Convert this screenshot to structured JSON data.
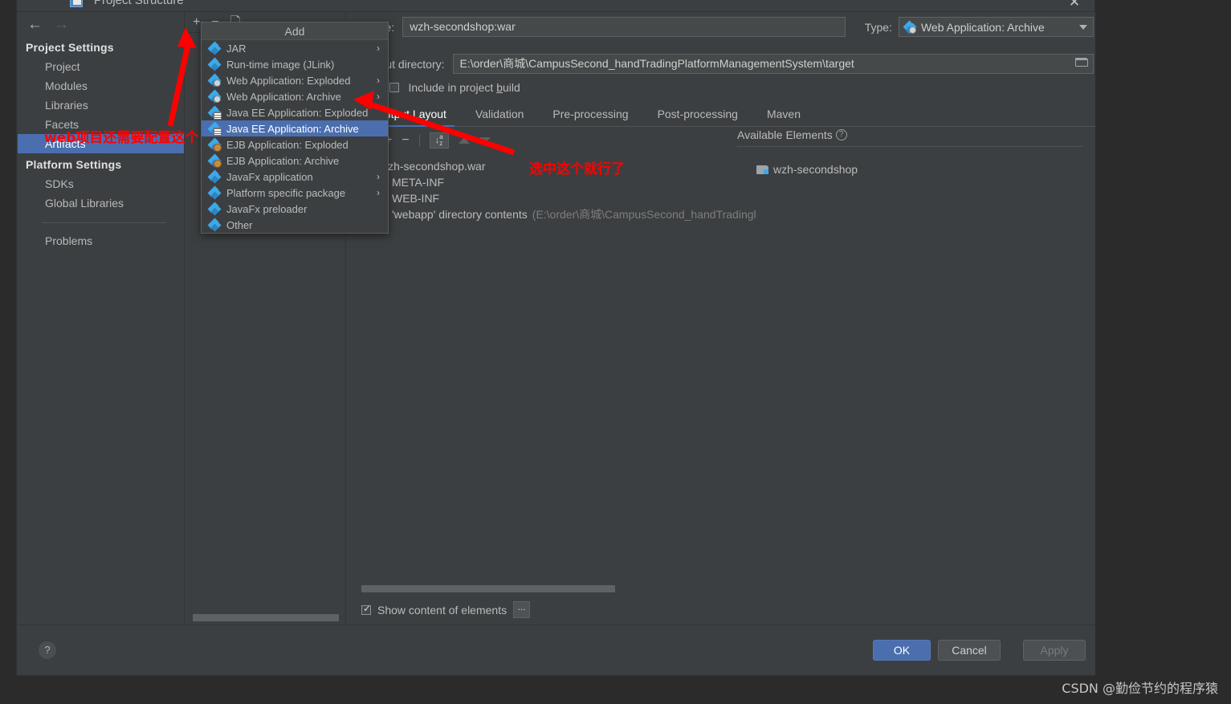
{
  "window": {
    "title": "Project Structure",
    "close_label": "✕",
    "icon": "project-structure-icon"
  },
  "nav": {
    "back_label": "←",
    "forward_label": "→",
    "groups": [
      {
        "title": "Project Settings",
        "items": [
          {
            "label": "Project",
            "selected": false
          },
          {
            "label": "Modules",
            "selected": false
          },
          {
            "label": "Libraries",
            "selected": false
          },
          {
            "label": "Facets",
            "selected": false
          },
          {
            "label": "Artifacts",
            "selected": true
          }
        ]
      },
      {
        "title": "Platform Settings",
        "items": [
          {
            "label": "SDKs",
            "selected": false
          },
          {
            "label": "Global Libraries",
            "selected": false
          }
        ]
      }
    ],
    "problems_label": "Problems"
  },
  "artifacts_toolbar": {
    "add_label": "+",
    "remove_label": "−",
    "copy_label": "copy-icon"
  },
  "content": {
    "name_label": "Name:",
    "name_value": "wzh-secondshop:war",
    "type_label": "Type:",
    "type_value": "Web Application: Archive",
    "output_dir_label": "Output directory:",
    "output_dir_value": "E:\\order\\商城\\CampusSecond_handTradingPlatformManagementSystem\\target",
    "include_in_build_label_pre": "Include in project ",
    "include_in_build_label_key": "b",
    "include_in_build_label_post": "uild",
    "include_in_build_checked": false,
    "tabs": [
      {
        "label": "Output Layout",
        "active": true
      },
      {
        "label": "Validation",
        "active": false
      },
      {
        "label": "Pre-processing",
        "active": false
      },
      {
        "label": "Post-processing",
        "active": false
      },
      {
        "label": "Maven",
        "active": false
      }
    ],
    "layout_toolbar": {
      "jar_label": "create-archive-icon",
      "add_label": "+",
      "remove_label": "−",
      "sort_label": "sort-az-icon",
      "move_up_label": "move-up-icon",
      "move_down_label": "move-down-icon"
    },
    "output_tree": [
      {
        "label": "wzh-secondshop.war",
        "icon": "war-icon",
        "depth": 0,
        "hint": ""
      },
      {
        "label": "META-INF",
        "icon": "folder-icon",
        "depth": 1,
        "hint": ""
      },
      {
        "label": "WEB-INF",
        "icon": "folder-icon",
        "depth": 1,
        "hint": ""
      },
      {
        "label": "'webapp' directory contents",
        "icon": "dir-contents-icon",
        "depth": 1,
        "hint": "(E:\\order\\商城\\CampusSecond_handTradingl"
      }
    ],
    "available_elements_label": "Available Elements",
    "available_help_label": "?",
    "available_tree": [
      {
        "label": "wzh-secondshop",
        "icon": "module-folder-icon"
      }
    ],
    "show_content_label": "Show content of elements",
    "show_content_checked": true,
    "more_button_label": "..."
  },
  "menu": {
    "header": "Add",
    "items": [
      {
        "label": "JAR",
        "icon": "jar-icon",
        "submenu": true,
        "selected": false
      },
      {
        "label": "Run-time image (JLink)",
        "icon": "jar-icon",
        "submenu": false,
        "selected": false
      },
      {
        "label": "Web Application: Exploded",
        "icon": "web-icon",
        "submenu": true,
        "selected": false
      },
      {
        "label": "Web Application: Archive",
        "icon": "web-icon",
        "submenu": true,
        "selected": false
      },
      {
        "label": "Java EE Application: Exploded",
        "icon": "jee-icon",
        "submenu": false,
        "selected": false
      },
      {
        "label": "Java EE Application: Archive",
        "icon": "jee-icon",
        "submenu": false,
        "selected": true
      },
      {
        "label": "EJB Application: Exploded",
        "icon": "ejb-icon",
        "submenu": false,
        "selected": false
      },
      {
        "label": "EJB Application: Archive",
        "icon": "ejb-icon",
        "submenu": false,
        "selected": false
      },
      {
        "label": "JavaFx application",
        "icon": "jar-icon",
        "submenu": true,
        "selected": false
      },
      {
        "label": "Platform specific package",
        "icon": "jar-icon",
        "submenu": true,
        "selected": false
      },
      {
        "label": "JavaFx preloader",
        "icon": "jar-icon",
        "submenu": false,
        "selected": false
      },
      {
        "label": "Other",
        "icon": "jar-icon",
        "submenu": false,
        "selected": false
      }
    ]
  },
  "footer": {
    "help_label": "?",
    "ok_label": "OK",
    "cancel_label": "Cancel",
    "apply_label": "Apply"
  },
  "annotations": {
    "note_artifacts": "web项目还需要配置这个",
    "note_menu": "选中这个就行了",
    "arrow_color": "#ff0000"
  },
  "watermark": "CSDN @勤俭节约的程序猿",
  "colors": {
    "window_bg": "#3c3f41",
    "panel_bg": "#45494a",
    "selection_blue": "#4b6eaf",
    "accent_icon_blue": "#3ea8e8",
    "text": "#bbbbbb",
    "outer_bg": "#2b2b2b"
  }
}
